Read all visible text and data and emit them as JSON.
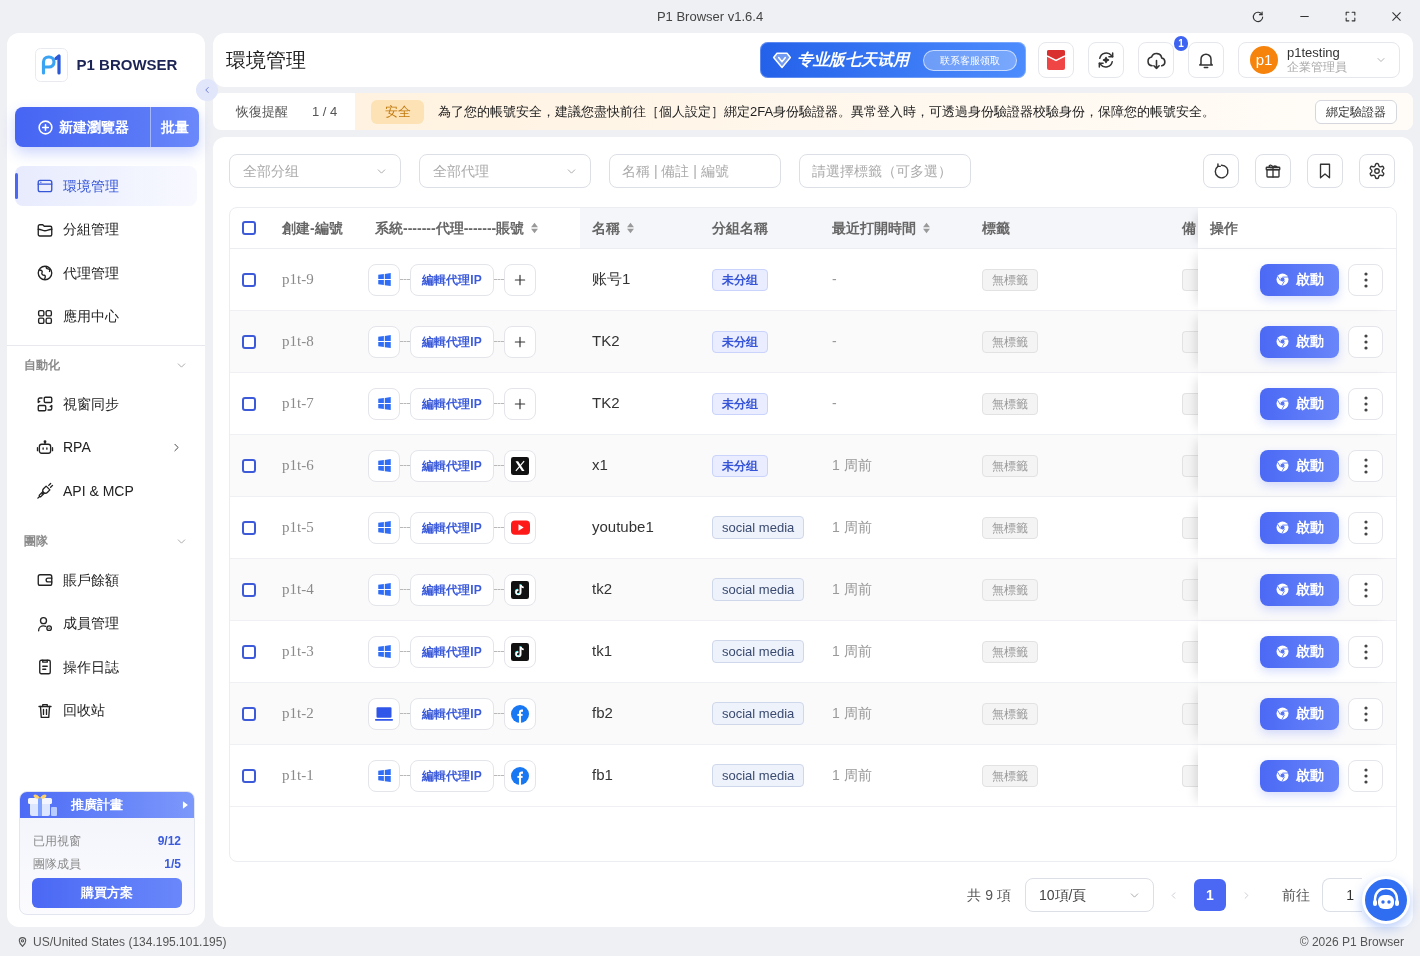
{
  "window": {
    "title": "P1 Browser v1.6.4"
  },
  "sidebar": {
    "logo_text": "P1 BROWSER",
    "new_button": "新建瀏覽器",
    "batch_button": "批量",
    "sections": [
      {
        "items": [
          {
            "label": "環境管理",
            "selected": true,
            "submenu": false
          },
          {
            "label": "分組管理",
            "selected": false,
            "submenu": false
          },
          {
            "label": "代理管理",
            "selected": false,
            "submenu": false
          },
          {
            "label": "應用中心",
            "selected": false,
            "submenu": false
          }
        ]
      },
      {
        "title": "自動化",
        "expanded": true,
        "items": [
          {
            "label": "視窗同步",
            "selected": false,
            "submenu": false
          },
          {
            "label": "RPA",
            "selected": false,
            "submenu": true
          },
          {
            "label": "API & MCP",
            "selected": false,
            "submenu": false
          }
        ]
      },
      {
        "title": "團隊",
        "expanded": true,
        "items": [
          {
            "label": "賬戶餘額",
            "selected": false,
            "submenu": false
          },
          {
            "label": "成員管理",
            "selected": false,
            "submenu": false
          },
          {
            "label": "操作日誌",
            "selected": false,
            "submenu": false
          },
          {
            "label": "回收站",
            "selected": false,
            "submenu": false
          }
        ]
      }
    ],
    "promo": {
      "title": "推廣計畫",
      "stats": [
        {
          "label": "已用視窗",
          "value": "9/12"
        },
        {
          "label": "團隊成員",
          "value": "1/5"
        }
      ],
      "button": "購買方案"
    }
  },
  "header": {
    "title": "環境管理",
    "trial_banner": {
      "title": "专业版七天试用",
      "button": "联系客服领取"
    },
    "download_badge": "1",
    "user": {
      "avatar": "p1",
      "name": "p1testing",
      "role": "企業管理員"
    }
  },
  "notice": {
    "label": "恢復提醒",
    "counter": "1 / 4",
    "tag": "安全",
    "message": "為了您的帳號安全，建議您盡快前往［個人設定］綁定2FA身份驗證器。異常登入時，可透過身份驗證器校驗身份，保障您的帳號安全。",
    "button": "綁定驗證器"
  },
  "filters": [
    {
      "kind": "select",
      "placeholder": "全部分组"
    },
    {
      "kind": "select",
      "placeholder": "全部代理"
    },
    {
      "kind": "input",
      "placeholder": "名稱 | 備註 | 編號"
    },
    {
      "kind": "input",
      "placeholder": "請選擇標籤（可多選）"
    }
  ],
  "table": {
    "select_all": {
      "checked": false
    },
    "columns": [
      {
        "label": "創建-編號",
        "sortable": false
      },
      {
        "label": "系統-------代理-------賬號",
        "sortable": true
      },
      {
        "label": "名稱",
        "sortable": true
      },
      {
        "label": "分組名稱",
        "sortable": false
      },
      {
        "label": "最近打開時間",
        "sortable": true
      },
      {
        "label": "標籤",
        "sortable": false
      },
      {
        "label": "備",
        "sortable": false
      },
      {
        "label": "操作",
        "sortable": false
      }
    ],
    "rows": [
      {
        "checked": false,
        "id": "p1t-9",
        "os": {
          "kind": "windows"
        },
        "proxy": "編輯代理IP",
        "account": {
          "kind": "add"
        },
        "name": "账号1",
        "group": {
          "label": "未分组",
          "kind": "ungrouped"
        },
        "last_opened": "-",
        "tag": "無標籤",
        "action": "啟動"
      },
      {
        "checked": false,
        "id": "p1t-8",
        "os": {
          "kind": "windows"
        },
        "proxy": "編輯代理IP",
        "account": {
          "kind": "add"
        },
        "name": "TK2",
        "group": {
          "label": "未分组",
          "kind": "ungrouped"
        },
        "last_opened": "-",
        "tag": "無標籤",
        "action": "啟動"
      },
      {
        "checked": false,
        "id": "p1t-7",
        "os": {
          "kind": "windows"
        },
        "proxy": "編輯代理IP",
        "account": {
          "kind": "add"
        },
        "name": "TK2",
        "group": {
          "label": "未分组",
          "kind": "ungrouped"
        },
        "last_opened": "-",
        "tag": "無標籤",
        "action": "啟動"
      },
      {
        "checked": false,
        "id": "p1t-6",
        "os": {
          "kind": "windows"
        },
        "proxy": "編輯代理IP",
        "account": {
          "kind": "x"
        },
        "name": "x1",
        "group": {
          "label": "未分组",
          "kind": "ungrouped"
        },
        "last_opened": "1 周前",
        "tag": "無標籤",
        "action": "啟動"
      },
      {
        "checked": false,
        "id": "p1t-5",
        "os": {
          "kind": "windows"
        },
        "proxy": "編輯代理IP",
        "account": {
          "kind": "youtube"
        },
        "name": "youtube1",
        "group": {
          "label": "social media",
          "kind": "group"
        },
        "last_opened": "1 周前",
        "tag": "無標籤",
        "action": "啟動"
      },
      {
        "checked": false,
        "id": "p1t-4",
        "os": {
          "kind": "windows"
        },
        "proxy": "編輯代理IP",
        "account": {
          "kind": "tiktok"
        },
        "name": "tk2",
        "group": {
          "label": "social media",
          "kind": "group"
        },
        "last_opened": "1 周前",
        "tag": "無標籤",
        "action": "啟動"
      },
      {
        "checked": false,
        "id": "p1t-3",
        "os": {
          "kind": "windows"
        },
        "proxy": "編輯代理IP",
        "account": {
          "kind": "tiktok"
        },
        "name": "tk1",
        "group": {
          "label": "social media",
          "kind": "group"
        },
        "last_opened": "1 周前",
        "tag": "無標籤",
        "action": "啟動"
      },
      {
        "checked": false,
        "id": "p1t-2",
        "os": {
          "kind": "laptop"
        },
        "proxy": "編輯代理IP",
        "account": {
          "kind": "facebook"
        },
        "name": "fb2",
        "group": {
          "label": "social media",
          "kind": "group"
        },
        "last_opened": "1 周前",
        "tag": "無標籤",
        "action": "啟動"
      },
      {
        "checked": false,
        "id": "p1t-1",
        "os": {
          "kind": "windows"
        },
        "proxy": "編輯代理IP",
        "account": {
          "kind": "facebook"
        },
        "name": "fb1",
        "group": {
          "label": "social media",
          "kind": "group"
        },
        "last_opened": "1 周前",
        "tag": "無標籤",
        "action": "啟動"
      }
    ]
  },
  "pagination": {
    "total": "共 9 項",
    "page_size": "10項/頁",
    "pages": [
      {
        "label": "1",
        "selected": true
      }
    ],
    "goto_label": "前往",
    "goto_value": "1"
  },
  "footer": {
    "location": "US/United States (134.195.101.195)",
    "copyright": "© 2026 P1 Browser"
  }
}
